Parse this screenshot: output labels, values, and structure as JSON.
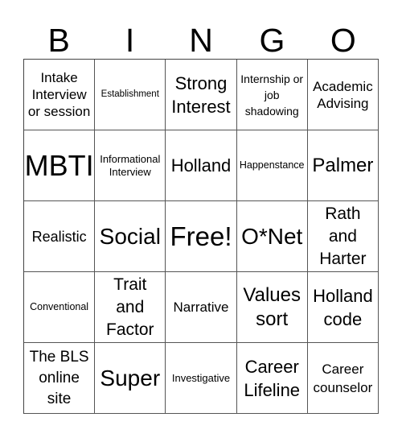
{
  "header": {
    "letters": [
      "B",
      "I",
      "N",
      "G",
      "O"
    ]
  },
  "cells": [
    [
      "Intake Interview or session",
      "Establishment",
      "Strong Interest",
      "Internship or job shadowing",
      "Academic Advising"
    ],
    [
      "MBTI",
      "Informational Interview",
      "Holland",
      "Happenstance",
      "Palmer"
    ],
    [
      "Realistic",
      "Social",
      "Free!",
      "O*Net",
      "Rath and Harter"
    ],
    [
      "Conventional",
      "Trait and Factor",
      "Narrative",
      "Values sort",
      "Holland code"
    ],
    [
      "The BLS online site",
      "Super",
      "Investigative",
      "Career Lifeline",
      "Career counselor"
    ]
  ]
}
